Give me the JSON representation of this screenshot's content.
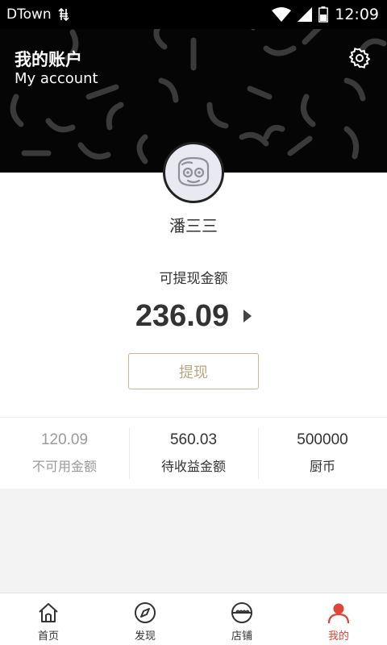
{
  "status_bar": {
    "carrier": "DTown",
    "time": "12:09",
    "icons": [
      "data-transfer-icon",
      "wifi-icon",
      "signal-icon",
      "battery-icon"
    ]
  },
  "header": {
    "title": "我的账户",
    "subtitle": "My account",
    "settings_icon": "gear-icon"
  },
  "profile": {
    "avatar_icon": "robot-face-avatar-icon",
    "username": "潘三三"
  },
  "balance": {
    "label": "可提现金额",
    "value": "236.09",
    "withdraw_button": "提现"
  },
  "stats": [
    {
      "value": "120.09",
      "label": "不可用金额"
    },
    {
      "value": "560.03",
      "label": "待收益金额"
    },
    {
      "value": "500000",
      "label": "厨币"
    }
  ],
  "bottom_nav": {
    "items": [
      {
        "label": "首页",
        "icon": "home-icon"
      },
      {
        "label": "发现",
        "icon": "compass-icon"
      },
      {
        "label": "店铺",
        "icon": "shop-icon"
      },
      {
        "label": "我的",
        "icon": "person-icon"
      }
    ],
    "active_index": 3
  },
  "colors": {
    "accent": "#e04535",
    "withdraw_border": "#c9b896",
    "withdraw_text": "#b9a67f",
    "header_bg": "#050505"
  }
}
